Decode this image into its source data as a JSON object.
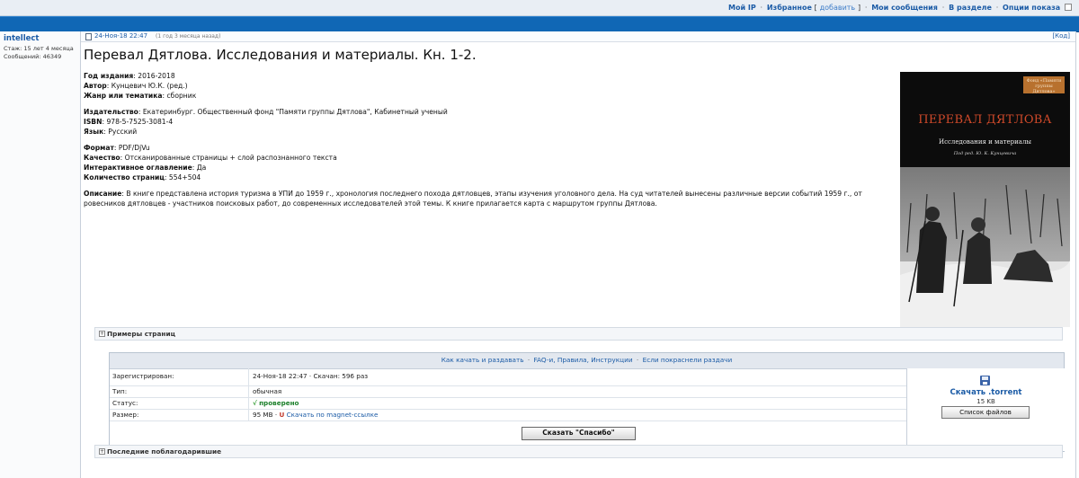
{
  "topnav": {
    "my_ip": "Мой IP",
    "favorites": "Избранное",
    "add_open": "[",
    "add": "добавить",
    "add_close": "]",
    "my_messages": "Мои сообщения",
    "in_section": "В разделе",
    "view_options": "Опции показа"
  },
  "user": {
    "name": "intellect",
    "tenure": "Стаж: 15 лет 4 месяца",
    "messages": "Сообщений: 46349"
  },
  "post": {
    "date": "24-Ноя-18 22:47",
    "ago": "(1 год 3 месяца назад)",
    "code_link": "[Код]",
    "title": "Перевал Дятлова. Исследования и материалы. Кн. 1-2."
  },
  "book": {
    "year_label": "Год издания",
    "year": "2016-2018",
    "author_label": "Автор",
    "author": "Кунцевич Ю.К. (ред.)",
    "genre_label": "Жанр или тематика",
    "genre": "сборник",
    "publisher_label": "Издательство",
    "publisher": "Екатеринбург. Общественный фонд \"Памяти группы Дятлова\", Кабинетный ученый",
    "isbn_label": "ISBN",
    "isbn": "978-5-7525-3081-4",
    "lang_label": "Язык",
    "lang": "Русский",
    "format_label": "Формат",
    "format": "PDF/DjVu",
    "quality_label": "Качество",
    "quality": "Отсканированные страницы + слой распознанного текста",
    "toc_label": "Интерактивное оглавление",
    "toc": "Да",
    "pages_label": "Количество страниц",
    "pages": "554+504",
    "desc_label": "Описание",
    "desc": "В книге представлена история туризма в УПИ до 1959 г., хронология последнего похода дятловцев, этапы изучения уголовного дела. На суд читателей вынесены различные версии событий 1959 г., от ровесников дятловцев - участников поисковых работ, до современных исследователей этой темы. К книге прилагается карта с маршрутом группы Дятлова."
  },
  "cover": {
    "badge": "Фонд «Памяти группы Дятлова»",
    "title": "ПЕРЕВАЛ ДЯТЛОВА",
    "subtitle": "Исследования и материалы",
    "editor": "Под ред. Ю. К. Кунцевича"
  },
  "spoilers": {
    "pages": "Примеры страниц",
    "thanked": "Последние поблагодарившие"
  },
  "torrent": {
    "links": [
      "Как качать и раздавать",
      "FAQ-и, Правила, Инструкции",
      "Если покраснели раздачи"
    ],
    "registered_label": "Зарегистрирован:",
    "registered": "24-Ноя-18 22:47",
    "downloaded": "Скачан: 596 раз",
    "type_label": "Тип:",
    "type": "обычная",
    "status_label": "Статус:",
    "status": "проверено",
    "size_label": "Размер:",
    "size": "95 MB",
    "magnet": "Скачать по magnet-ссылке",
    "download": "Скачать .torrent",
    "torrent_size": "15 KB",
    "file_list": "Список файлов"
  },
  "thanks_button": "Сказать \"Спасибо\""
}
